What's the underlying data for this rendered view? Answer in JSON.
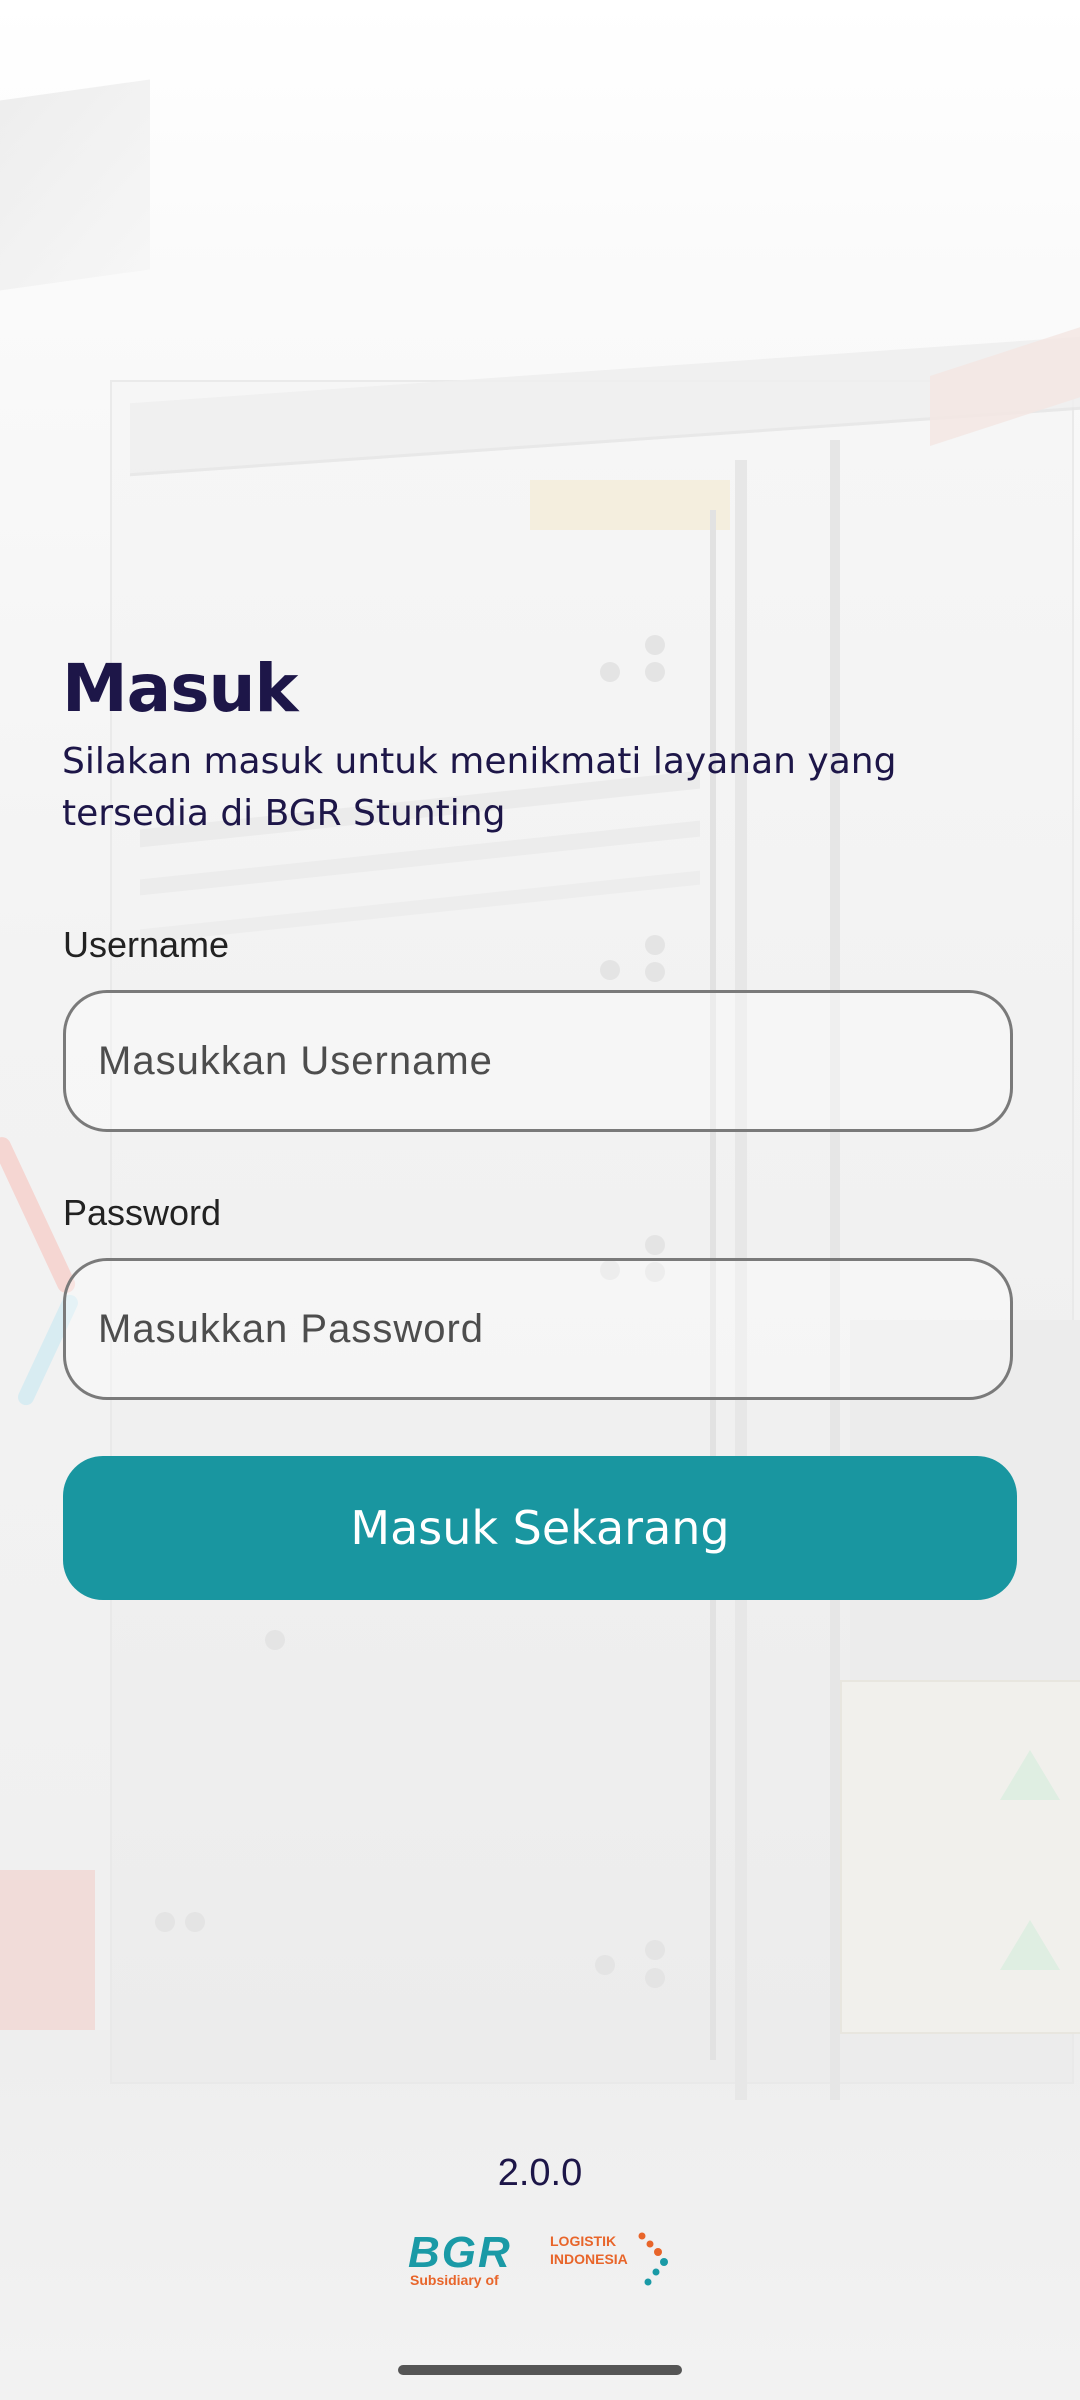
{
  "login": {
    "title": "Masuk",
    "subtitle": "Silakan masuk untuk menikmati layanan yang tersedia di BGR Stunting",
    "username_label": "Username",
    "username_placeholder": "Masukkan Username",
    "username_value": "",
    "password_label": "Password",
    "password_placeholder": "Masukkan Password",
    "password_value": "",
    "submit_label": "Masuk Sekarang"
  },
  "footer": {
    "version": "2.0.0",
    "logo": {
      "brand": "BGR",
      "subsidiary": "Subsidiary of",
      "logistik": "LOGISTIK",
      "indonesia": "INDONESIA"
    }
  },
  "colors": {
    "primary": "#1996a0",
    "heading": "#1d1648",
    "logo_teal": "#1a9aa6",
    "logo_orange": "#e8652a"
  }
}
